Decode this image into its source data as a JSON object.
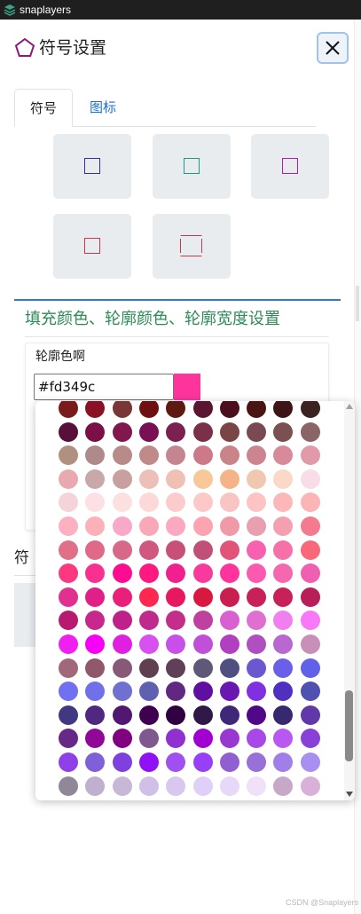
{
  "titlebar": {
    "title": "snaplayers"
  },
  "dialog": {
    "title": "符号设置",
    "close_label": "close"
  },
  "tabs": [
    {
      "label": "符号",
      "active": true
    },
    {
      "label": "图标",
      "active": false
    }
  ],
  "symbols": [
    {
      "kind": "square",
      "color": "#2c2fb0"
    },
    {
      "kind": "square",
      "color": "#1b9a86"
    },
    {
      "kind": "square",
      "color": "#b01fb0"
    },
    {
      "kind": "square",
      "color": "#d23549"
    },
    {
      "kind": "bracket-rect",
      "color": "#c23b4a"
    }
  ],
  "section": {
    "title": "填充颜色、轮廓颜色、轮廓宽度设置"
  },
  "outline_color": {
    "label": "轮廓色啊",
    "value": "#fd349c",
    "swatch": "#fd349c"
  },
  "underlay": {
    "label": "符"
  },
  "color_popup": {
    "columns": 10,
    "palette": [
      [
        "#7b1a1a",
        "#8a1225",
        "#7a3535",
        "#6f1010",
        "#5e1a12",
        "#5a1530",
        "#4b0f1e",
        "#4a1412",
        "#3e1516",
        "#3a2320"
      ],
      [
        "#5a0f3a",
        "#7a1045",
        "#80184e",
        "#7a0f55",
        "#7b2050",
        "#7a3048",
        "#7a4545",
        "#7a4a52",
        "#7a5050",
        "#8a6466"
      ],
      [
        "#b09080",
        "#b08a8a",
        "#b88a88",
        "#c08a88",
        "#c48590",
        "#cc7a8a",
        "#c88488",
        "#cc8590",
        "#d88a9a",
        "#e09aa8"
      ],
      [
        "#e8aab0",
        "#c8a8a8",
        "#c8a0a0",
        "#ecc0b8",
        "#f0c0b4",
        "#f8c898",
        "#f5b488",
        "#f0c8b0",
        "#fcd8c8",
        "#f8dce8"
      ],
      [
        "#f4d4d8",
        "#fce0e4",
        "#fce0e0",
        "#fcd8d8",
        "#fccccc",
        "#fcc8c8",
        "#f8c4c4",
        "#fcc4c4",
        "#fcb8b8",
        "#fcb4b4"
      ],
      [
        "#fcb0c0",
        "#fcb0b8",
        "#f8a8c8",
        "#f8a8b8",
        "#fca8c0",
        "#fca4b0",
        "#f09aa8",
        "#e8a0b0",
        "#f4a0b0",
        "#f47a90"
      ],
      [
        "#e07088",
        "#e06888",
        "#d86888",
        "#d05880",
        "#c85078",
        "#c05078",
        "#e0547a",
        "#f860b0",
        "#f870a8",
        "#f86878"
      ],
      [
        "#fc3880",
        "#f83090",
        "#fc0c90",
        "#fc1a80",
        "#f02090",
        "#f83a9c",
        "#fc349c",
        "#fc5ab0",
        "#f468b0",
        "#f060b0"
      ],
      [
        "#e03090",
        "#e02088",
        "#e8207a",
        "#fc2850",
        "#e81860",
        "#d81840",
        "#c81e50",
        "#c82058",
        "#c82058",
        "#b81e58"
      ],
      [
        "#b81a70",
        "#c8288c",
        "#c0208a",
        "#c02a8c",
        "#c42e8a",
        "#c040a0",
        "#d860d0",
        "#e070d0",
        "#f080f0",
        "#f878f8"
      ],
      [
        "#f020f0",
        "#f800f8",
        "#e020e0",
        "#d850f0",
        "#c850e8",
        "#c050d8",
        "#b040c0",
        "#b050c0",
        "#b868d0",
        "#c890b8"
      ],
      [
        "#a06878",
        "#905868",
        "#885878",
        "#604050",
        "#604058",
        "#605878",
        "#505080",
        "#6a58d0",
        "#6a60e8",
        "#6060e8"
      ],
      [
        "#7070f0",
        "#7070e8",
        "#7070d0",
        "#6060b0",
        "#602880",
        "#6010a0",
        "#6818b0",
        "#8030e0",
        "#5030c0",
        "#5050b0"
      ],
      [
        "#403880",
        "#502880",
        "#501870",
        "#400050",
        "#300040",
        "#301848",
        "#402878",
        "#500888",
        "#382870",
        "#6038a8"
      ],
      [
        "#682888",
        "#900898",
        "#800080",
        "#805890",
        "#9030d0",
        "#a000d0",
        "#9838d0",
        "#a848e8",
        "#b858f0",
        "#8840d8"
      ],
      [
        "#9040e8",
        "#8060d8",
        "#8040e0",
        "#9010f8",
        "#a050f0",
        "#9840f8",
        "#9060d0",
        "#9870d8",
        "#a080e8",
        "#a890f0"
      ],
      [
        "#908898",
        "#c0b0d0",
        "#c8b8d8",
        "#d0c0e8",
        "#d8c8f0",
        "#e0d0f8",
        "#e8d8f8",
        "#f0e0f8",
        "#c8a8c8",
        "#d8b0d8"
      ]
    ]
  },
  "watermark": "CSDN @Snaplayers"
}
